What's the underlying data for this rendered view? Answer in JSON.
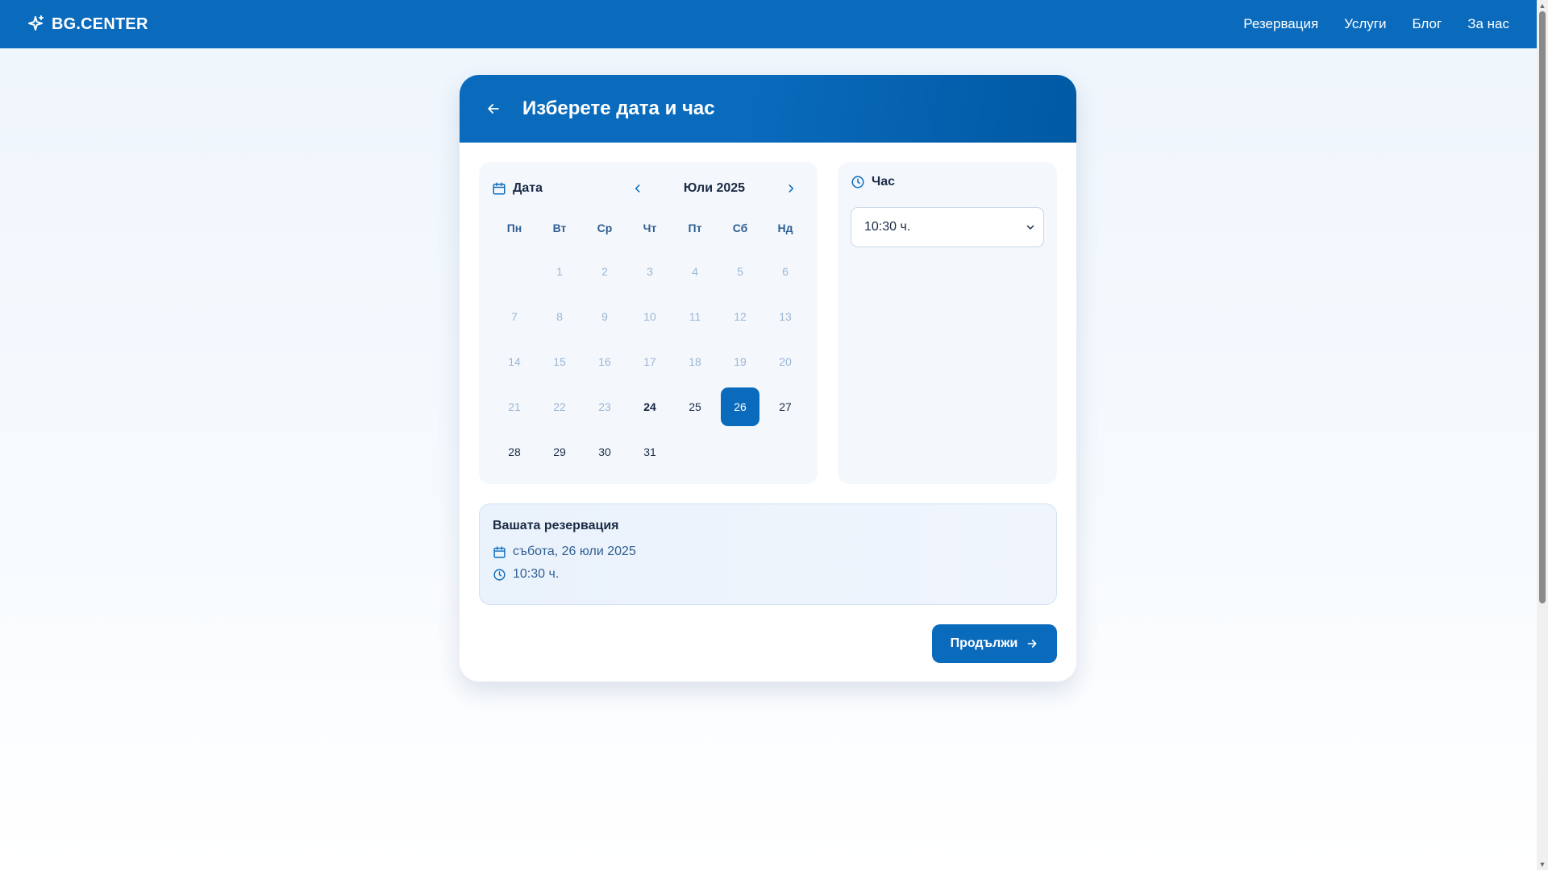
{
  "brand": {
    "name": "BG.CENTER",
    "icon": "sparkle-icon"
  },
  "nav": {
    "items": [
      {
        "label": "Резервация"
      },
      {
        "label": "Услуги"
      },
      {
        "label": "Блог"
      },
      {
        "label": "За нас"
      }
    ]
  },
  "page": {
    "title": "Изберете дата и час"
  },
  "calendar": {
    "label": "Дата",
    "month": "Юли 2025",
    "weekdays": [
      "Пн",
      "Вт",
      "Ср",
      "Чт",
      "Пт",
      "Сб",
      "Нд"
    ],
    "leading_blanks": 1,
    "days": [
      {
        "d": "1",
        "state": "disabled"
      },
      {
        "d": "2",
        "state": "disabled"
      },
      {
        "d": "3",
        "state": "disabled"
      },
      {
        "d": "4",
        "state": "disabled"
      },
      {
        "d": "5",
        "state": "disabled"
      },
      {
        "d": "6",
        "state": "disabled"
      },
      {
        "d": "7",
        "state": "disabled"
      },
      {
        "d": "8",
        "state": "disabled"
      },
      {
        "d": "9",
        "state": "disabled"
      },
      {
        "d": "10",
        "state": "disabled"
      },
      {
        "d": "11",
        "state": "disabled"
      },
      {
        "d": "12",
        "state": "disabled"
      },
      {
        "d": "13",
        "state": "disabled"
      },
      {
        "d": "14",
        "state": "disabled"
      },
      {
        "d": "15",
        "state": "disabled"
      },
      {
        "d": "16",
        "state": "disabled"
      },
      {
        "d": "17",
        "state": "disabled"
      },
      {
        "d": "18",
        "state": "disabled"
      },
      {
        "d": "19",
        "state": "disabled"
      },
      {
        "d": "20",
        "state": "disabled"
      },
      {
        "d": "21",
        "state": "disabled"
      },
      {
        "d": "22",
        "state": "disabled"
      },
      {
        "d": "23",
        "state": "disabled"
      },
      {
        "d": "24",
        "state": "today"
      },
      {
        "d": "25",
        "state": "active"
      },
      {
        "d": "26",
        "state": "selected"
      },
      {
        "d": "27",
        "state": "active"
      },
      {
        "d": "28",
        "state": "active"
      },
      {
        "d": "29",
        "state": "active"
      },
      {
        "d": "30",
        "state": "active"
      },
      {
        "d": "31",
        "state": "active"
      }
    ]
  },
  "time": {
    "label": "Час",
    "selected": "10:30 ч."
  },
  "summary": {
    "title": "Вашата резервация",
    "date": "събота, 26 юли 2025",
    "time": "10:30 ч."
  },
  "actions": {
    "continue": "Продължи"
  },
  "colors": {
    "primary": "#0a6bbd",
    "text": "#1b2b45",
    "muted": "#9ab6d4",
    "accent_text": "#2f5f93",
    "panel": "#f4f8fd"
  }
}
